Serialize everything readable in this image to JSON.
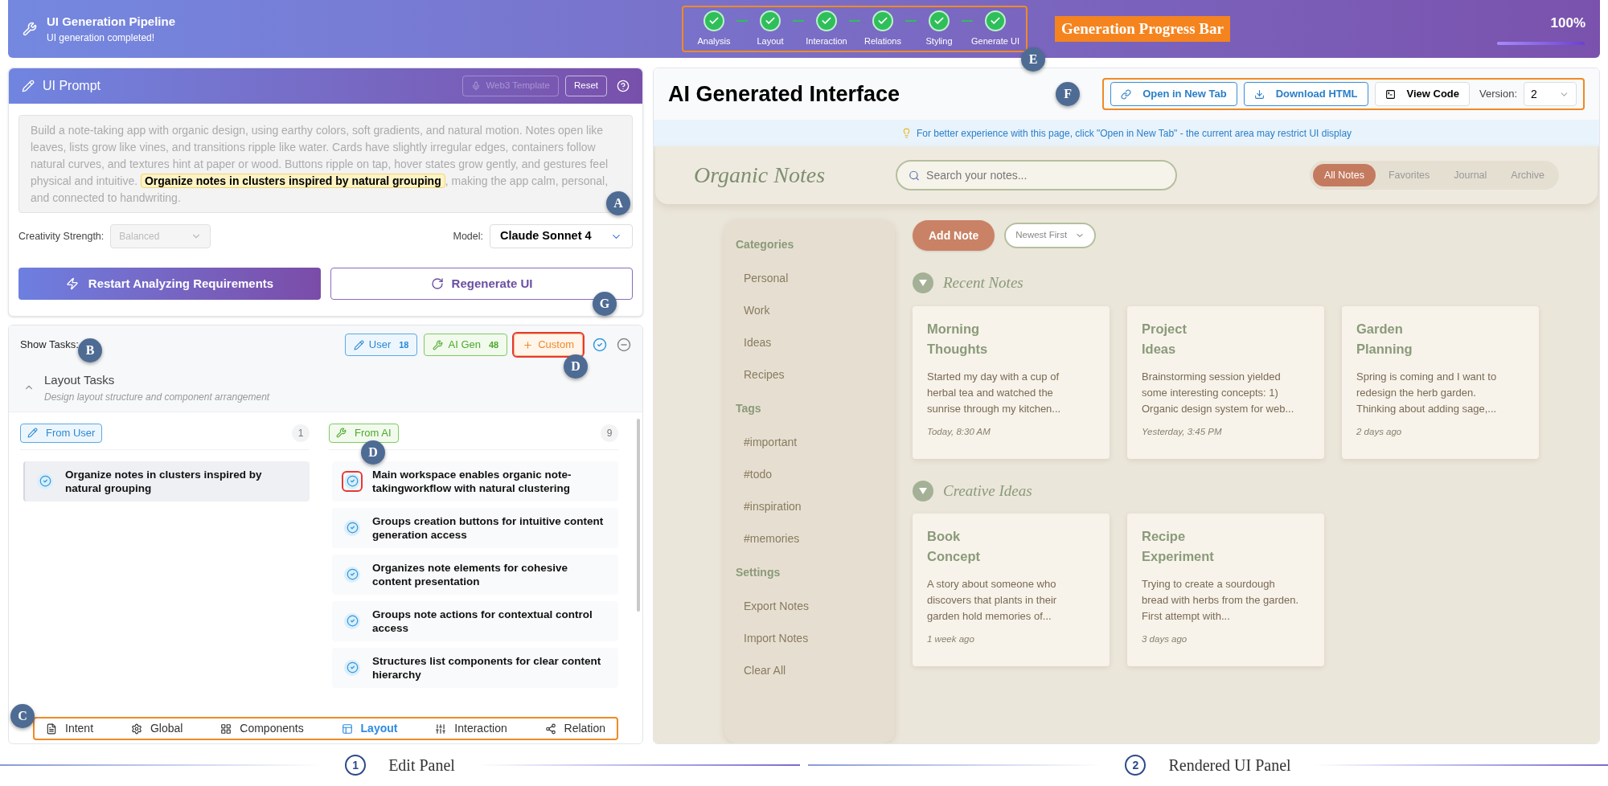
{
  "pipeline": {
    "title": "UI Generation Pipeline",
    "subtitle": "UI generation completed!",
    "outlined": true,
    "marker": "E",
    "caption": "Generation Progress Bar",
    "percent": "100%",
    "level": 1,
    "steps": [
      {
        "label": "Analysis",
        "done": true
      },
      {
        "label": "Layout",
        "done": true
      },
      {
        "label": "Interaction",
        "done": true
      },
      {
        "label": "Relations",
        "done": true
      },
      {
        "label": "Styling",
        "done": true
      },
      {
        "label": "Generate UI",
        "done": true
      }
    ]
  },
  "prompt_panel": {
    "title": "UI Prompt",
    "template_button": {
      "label": "Web3 Template",
      "disabled": true
    },
    "reset": "Reset",
    "marker": "A",
    "prompt_before": "Build a note-taking app with organic design, using earthy colors, soft gradients, and natural motion. Notes open like leaves, lists grow like vines, and transitions ripple like water. Cards have slightly irregular edges, containers follow natural curves, and textures hint at paper or wood. Buttons ripple on tap, hover states grow gently, and gestures feel physical and intuitive.",
    "highlight": "Organize notes in clusters inspired by natural grouping",
    "prompt_after": ", making the app calm, personal, and connected to handwriting.",
    "creativity": {
      "label": "Creativity Strength:",
      "value": "Balanced",
      "disabled": true
    },
    "model": {
      "label": "Model:",
      "value": "Claude Sonnet 4"
    },
    "primary_button": "Restart Analyzing Requirements",
    "regenerate": {
      "label": "Regenerate UI",
      "marker": "G"
    }
  },
  "tasks": {
    "label": "Show Tasks:",
    "marker": "B",
    "filters": [
      {
        "kind": "user",
        "label": "User",
        "count": "18",
        "flagged": false
      },
      {
        "kind": "ai",
        "label": "AI Gen",
        "count": "48",
        "flagged": false
      },
      {
        "kind": "custom",
        "label": "Custom",
        "flagged": true,
        "marker": "D"
      }
    ],
    "section": {
      "title": "Layout Tasks",
      "subtitle": "Design layout structure and component arrangement",
      "expanded": true
    },
    "user_column": {
      "label": "From User",
      "count": "1",
      "items": [
        {
          "text": "Organize notes in clusters inspired by natural grouping",
          "checked": true,
          "flagged": false
        }
      ]
    },
    "ai_column": {
      "label": "From AI",
      "count": "9",
      "items": [
        {
          "text": "Main workspace enables organic note-takingworkflow with natural clustering",
          "checked": true,
          "flagged": true,
          "marker": "D"
        },
        {
          "text": "Groups creation buttons for intuitive content generation access",
          "checked": true,
          "flagged": false
        },
        {
          "text": "Organizes note elements for cohesive content presentation",
          "checked": true,
          "flagged": false
        },
        {
          "text": "Groups note actions for contextual control access",
          "checked": true,
          "flagged": false
        },
        {
          "text": "Structures list components for clear content hierarchy",
          "checked": true,
          "flagged": false
        }
      ]
    },
    "tab_bar": {
      "outlined": true,
      "marker": "C",
      "tabs": [
        {
          "kind": "intent",
          "label": "Intent",
          "selected": false
        },
        {
          "kind": "global",
          "label": "Global",
          "selected": false
        },
        {
          "kind": "components",
          "label": "Components",
          "selected": false
        },
        {
          "kind": "layout",
          "label": "Layout",
          "selected": true
        },
        {
          "kind": "interaction",
          "label": "Interaction",
          "selected": false
        },
        {
          "kind": "relation",
          "label": "Relation",
          "selected": false
        }
      ]
    }
  },
  "preview": {
    "title": "AI Generated Interface",
    "marker": "F",
    "outlined": true,
    "actions": [
      {
        "kind": "link",
        "label": "Open in New Tab"
      },
      {
        "kind": "download",
        "label": "Download HTML"
      },
      {
        "kind": "code",
        "label": "View Code"
      }
    ],
    "version_label": "Version:",
    "version": "2",
    "notice": "For better experience with this page, click \"Open in New Tab\" - the current area may restrict UI display",
    "app": {
      "brand": "Organic Notes",
      "search_placeholder": "Search your notes...",
      "nav": [
        {
          "label": "All Notes",
          "selected": true
        },
        {
          "label": "Favorites",
          "selected": false
        },
        {
          "label": "Journal",
          "selected": false
        },
        {
          "label": "Archive",
          "selected": false
        }
      ],
      "add_button": "Add Note",
      "sort": "Newest First",
      "sidebar": [
        {
          "title": "Categories",
          "items": [
            "Personal",
            "Work",
            "Ideas",
            "Recipes"
          ]
        },
        {
          "title": "Tags",
          "items": [
            "#important",
            "#todo",
            "#inspiration",
            "#memories"
          ]
        },
        {
          "title": "Settings",
          "items": [
            "Export Notes",
            "Import Notes",
            "Clear All"
          ]
        }
      ],
      "groups": [
        {
          "title": "Recent Notes",
          "expanded": true,
          "notes": [
            {
              "title": "Morning Thoughts",
              "body": "Started my day with a cup of herbal tea and watched the sunrise through my kitchen...",
              "time": "Today, 8:30 AM"
            },
            {
              "title": "Project Ideas",
              "body": "Brainstorming session yielded some interesting concepts: 1) Organic design system for web...",
              "time": "Yesterday, 3:45 PM"
            },
            {
              "title": "Garden Planning",
              "body": "Spring is coming and I want to redesign the herb garden. Thinking about adding sage,...",
              "time": "2 days ago"
            }
          ]
        },
        {
          "title": "Creative Ideas",
          "expanded": true,
          "notes": [
            {
              "title": "Book Concept",
              "body": "A story about someone who discovers that plants in their garden hold memories of...",
              "time": "1 week ago"
            },
            {
              "title": "Recipe Experiment",
              "body": "Trying to create a sourdough bread with herbs from the garden. First attempt with...",
              "time": "3 days ago"
            }
          ]
        }
      ]
    }
  },
  "captions": [
    {
      "number": "1",
      "label": "Edit Panel"
    },
    {
      "number": "2",
      "label": "Rendered UI Panel"
    }
  ]
}
